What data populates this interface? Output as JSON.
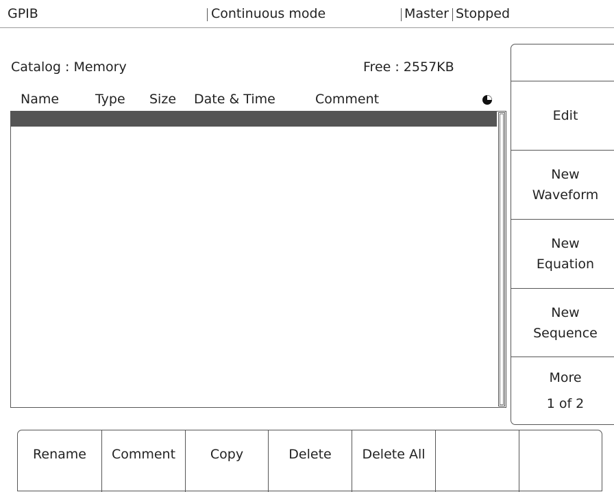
{
  "status": {
    "interface": "GPIB",
    "mode": "Continuous mode",
    "role": "Master",
    "state": "Stopped"
  },
  "catalog": {
    "title": "Catalog : Memory",
    "free": "Free : 2557KB",
    "columns": [
      "Name",
      "Type",
      "Size",
      "Date & Time",
      "Comment"
    ],
    "rows": []
  },
  "side_menu": {
    "top_blank": "",
    "edit": "Edit",
    "new_waveform": [
      "New",
      "Waveform"
    ],
    "new_equation": [
      "New",
      "Equation"
    ],
    "new_sequence": [
      "New",
      "Sequence"
    ],
    "more": [
      "More",
      "1 of 2"
    ]
  },
  "bottom_menu": {
    "items": [
      "Rename",
      "Comment",
      "Copy",
      "Delete",
      "Delete All",
      "",
      ""
    ]
  },
  "colors": {
    "selection_bar": "#555555",
    "border": "#555555"
  }
}
